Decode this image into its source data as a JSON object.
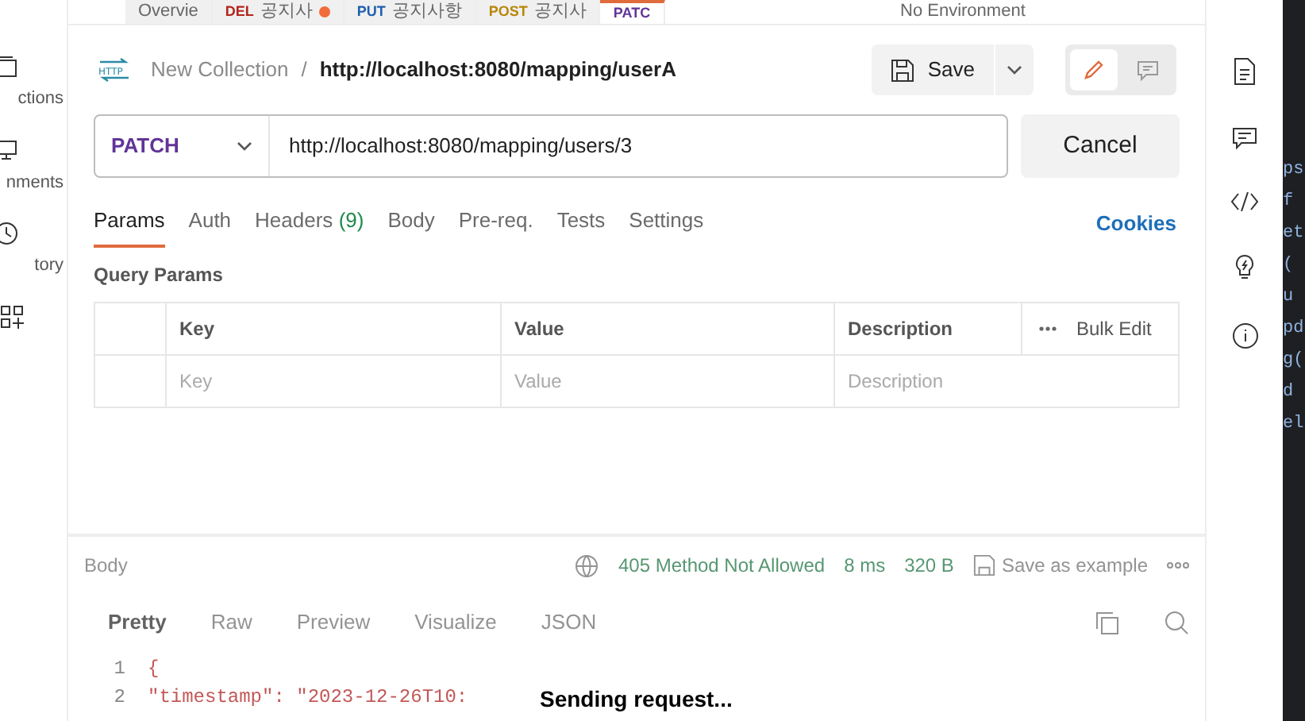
{
  "tabs": [
    {
      "label": "Overvie",
      "selected": false,
      "dot": false
    },
    {
      "method": "DEL",
      "label": "공지사",
      "selected": false,
      "dot": true
    },
    {
      "method": "PUT",
      "label": "공지사항",
      "selected": false,
      "dot": false
    },
    {
      "method": "POST",
      "label": "공지사",
      "selected": false,
      "dot": false
    },
    {
      "method": "PATC",
      "selected": true,
      "dot": false
    }
  ],
  "environment": "No Environment",
  "sidebar": [
    {
      "label": "ctions"
    },
    {
      "label": "nments"
    },
    {
      "label": "tory"
    }
  ],
  "http_icon_label": "HTTP",
  "breadcrumb": {
    "collection": "New Collection",
    "separator": "/",
    "request": "http://localhost:8080/mapping/userA"
  },
  "save_label": "Save",
  "mode_buttons": [
    {
      "selected": true
    },
    {
      "selected": false
    }
  ],
  "request": {
    "method": "PATCH",
    "url": "http://localhost:8080/mapping/users/3",
    "button": "Cancel"
  },
  "request_tabs": [
    {
      "label": "Params",
      "selected": true
    },
    {
      "label": "Auth",
      "selected": false
    },
    {
      "label": "Headers",
      "count": "(9)",
      "selected": false
    },
    {
      "label": "Body",
      "selected": false
    },
    {
      "label": "Pre-req.",
      "selected": false
    },
    {
      "label": "Tests",
      "selected": false
    },
    {
      "label": "Settings",
      "selected": false
    }
  ],
  "cookies": "Cookies",
  "query_params": {
    "title": "Query Params",
    "columns": [
      "Key",
      "Value",
      "Description"
    ],
    "bulk_edit": "Bulk Edit",
    "placeholders": [
      "Key",
      "Value",
      "Description"
    ]
  },
  "response": {
    "body_label": "Body",
    "status": "405 Method Not Allowed",
    "time": "8 ms",
    "size": "320 B",
    "save_example": "Save as example",
    "view_tabs": [
      {
        "label": "Pretty",
        "selected": true
      },
      {
        "label": "Raw",
        "selected": false
      },
      {
        "label": "Preview",
        "selected": false
      },
      {
        "label": "Visualize",
        "selected": false
      }
    ],
    "format": "JSON",
    "lines": [
      {
        "number": "1",
        "text": "{"
      },
      {
        "number": "2",
        "text": "\"timestamp\": \"2023-12-26T10:"
      }
    ]
  },
  "overlay": "Sending request...",
  "editor_fragments": [
    "ps",
    "f",
    "et",
    "(",
    "u",
    "pd",
    "g(",
    "d",
    "el"
  ]
}
